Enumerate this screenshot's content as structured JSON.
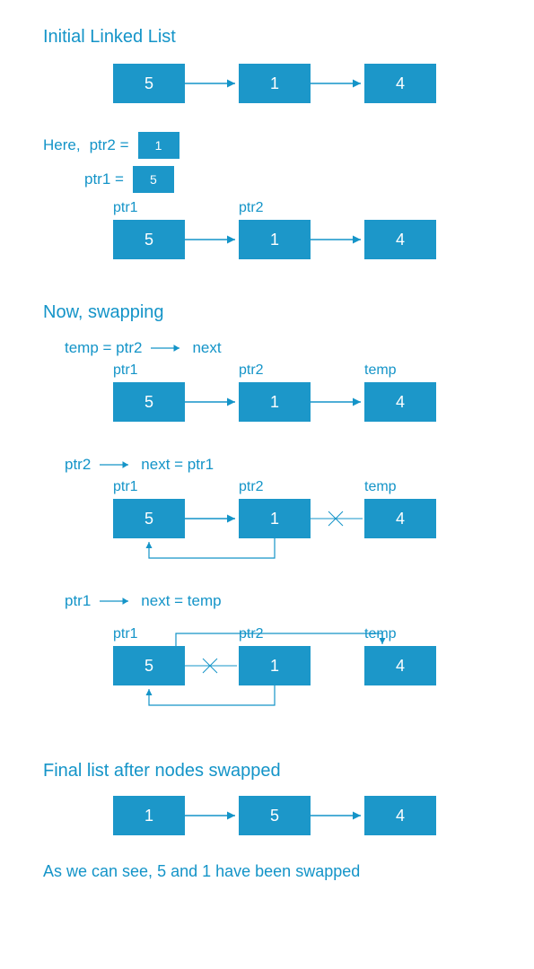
{
  "colors": {
    "primary": "#1494c8",
    "fill": "#1c97c9"
  },
  "headings": {
    "initial": "Initial Linked List",
    "swapping": "Now,   swapping",
    "final": "Final list after nodes swapped",
    "final_msg": "As we can see,  5 and 1 have been swapped"
  },
  "here": {
    "prefix": "Here,",
    "ptr2_label": "ptr2  =",
    "ptr2_val": "1",
    "ptr1_label": "ptr1  =",
    "ptr1_val": "5"
  },
  "labels": {
    "ptr1": "ptr1",
    "ptr2": "ptr2",
    "temp": "temp"
  },
  "expr": {
    "step1_lhs": "temp  =  ptr2",
    "step1_rhs": "next",
    "step2_lhs": "ptr2",
    "step2_mid": "next  =  ptr1",
    "step3_lhs": "ptr1",
    "step3_mid": "next  =  temp"
  },
  "lists": {
    "initial": [
      "5",
      "1",
      "4"
    ],
    "with_ptrs": [
      "5",
      "1",
      "4"
    ],
    "step1": [
      "5",
      "1",
      "4"
    ],
    "step2": [
      "5",
      "1",
      "4"
    ],
    "step3": [
      "5",
      "1",
      "4"
    ],
    "final": [
      "1",
      "5",
      "4"
    ]
  }
}
